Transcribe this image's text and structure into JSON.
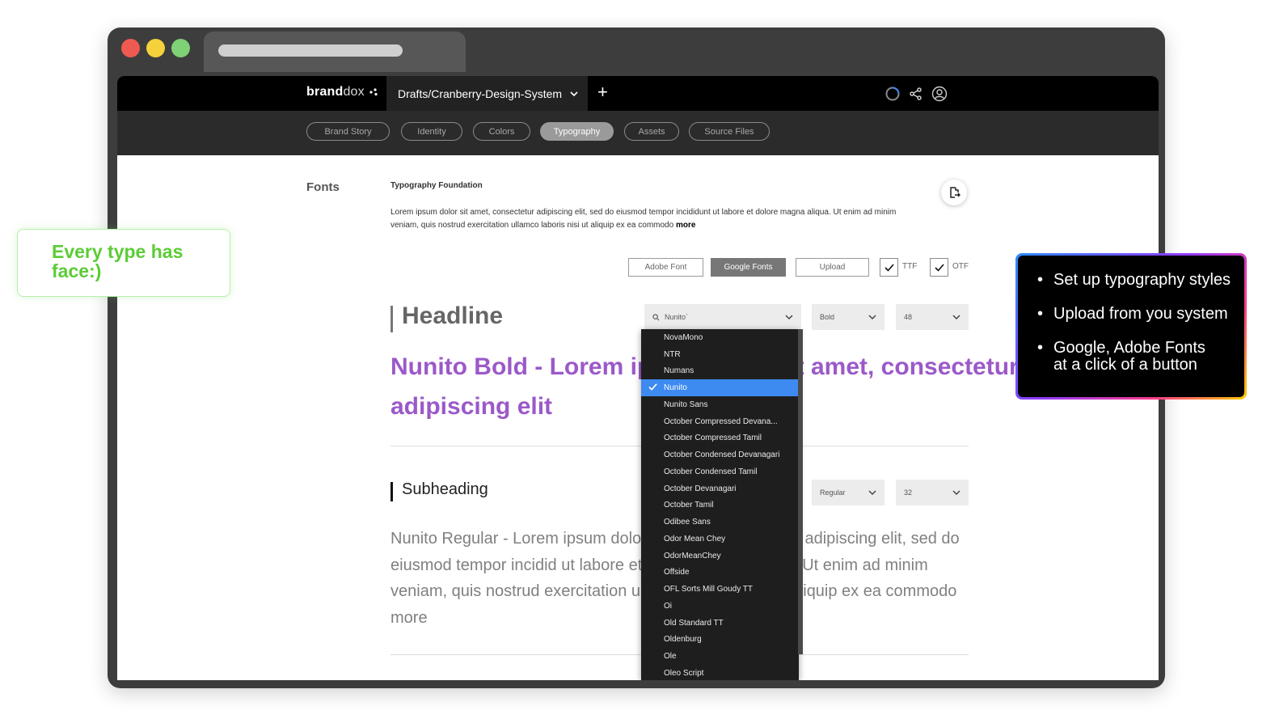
{
  "browser": {
    "traffic_lights": {
      "close": "#ee5a52",
      "minimize": "#f5d13b",
      "maximize": "#7fd175"
    }
  },
  "header": {
    "logo_bold": "brand",
    "logo_light": "dox",
    "project_path": "Drafts/Cranberry-Design-System",
    "add_label": "+"
  },
  "nav": {
    "items": [
      {
        "label": "Brand Story"
      },
      {
        "label": "Identity"
      },
      {
        "label": "Colors"
      },
      {
        "label": "Typography",
        "active": true
      },
      {
        "label": "Assets"
      },
      {
        "label": "Source Files"
      }
    ]
  },
  "content": {
    "section_title": "Fonts",
    "foundation_title": "Typography Foundation",
    "description": "Lorem ipsum dolor sit amet, consectetur adipiscing elit, sed do eiusmod tempor incididunt ut labore et dolore magna aliqua. Ut enim ad minim veniam, quis nostrud exercitation ullamco laboris nisi ut aliquip ex ea commodo ",
    "more_link": "more",
    "sources": {
      "adobe": "Adobe Font",
      "google": "Google Fonts",
      "upload": "Upload",
      "ttf": "TTF",
      "otf": "OTF"
    },
    "headline": {
      "label": "Headline",
      "font_search": "Nunito`",
      "weight": "Bold",
      "size": "48",
      "sample": "Nunito Bold - Lorem ipsum dolor sit amet, consectetur adipiscing elit"
    },
    "subheading": {
      "label": "Subheading",
      "weight": "Regular",
      "size": "32",
      "sample": "Nunito Regular - Lorem ipsum dolor sit amet, consectetur adipiscing elit, sed do eiusmod tempor incidid ut labore et dolore magna aliqua. Ut enim ad minim veniam, quis nostrud exercitation ullamco laboris nisi ut aliquip ex ea commodo more"
    }
  },
  "font_dropdown": {
    "selected": "Nunito",
    "items": [
      "NovaMono",
      "NTR",
      "Numans",
      "Nunito",
      "Nunito Sans",
      "October Compressed Devana...",
      "October Compressed Tamil",
      "October Condensed Devanagari",
      "October Condensed Tamil",
      "October Devanagari",
      "October Tamil",
      "Odibee Sans",
      "Odor Mean Chey",
      "OdorMeanChey",
      "Offside",
      "OFL Sorts Mill Goudy TT",
      "Oi",
      "Old Standard TT",
      "Oldenburg",
      "Ole",
      "Oleo Script"
    ]
  },
  "callouts": {
    "left": "Every type has\nface:)",
    "right": [
      "Set up typography styles",
      "Upload from you system",
      "Google, Adobe Fonts at a click of a button"
    ]
  }
}
